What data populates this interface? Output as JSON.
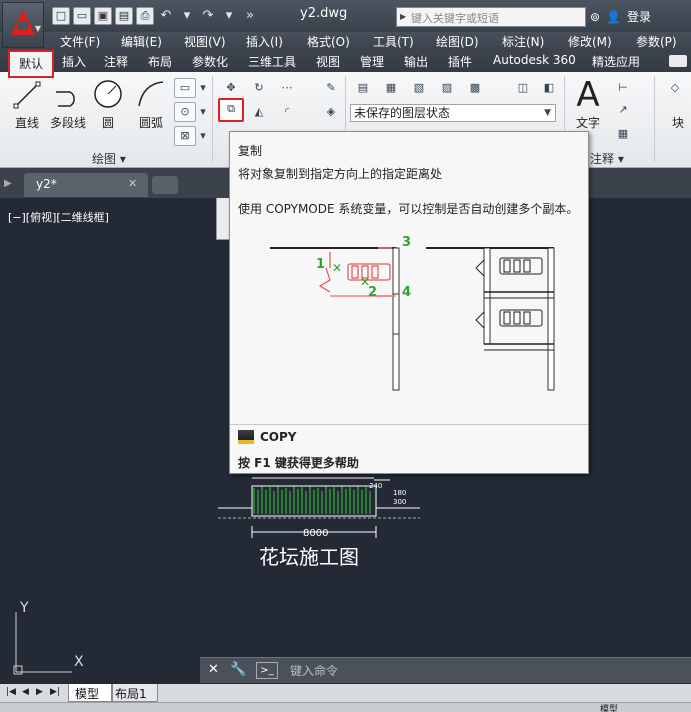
{
  "app": {
    "doc_title": "y2.dwg",
    "search_placeholder": "键入关键字或短语",
    "login": "登录"
  },
  "menu": [
    "文件(F)",
    "编辑(E)",
    "视图(V)",
    "插入(I)",
    "格式(O)",
    "工具(T)",
    "绘图(D)",
    "标注(N)",
    "修改(M)",
    "参数(P)"
  ],
  "ribbon_tabs": [
    "默认",
    "插入",
    "注释",
    "布局",
    "参数化",
    "三维工具",
    "视图",
    "管理",
    "输出",
    "插件",
    "Autodesk 360",
    "精选应用"
  ],
  "draw_panel": {
    "tools": [
      "直线",
      "多段线",
      "圆",
      "圆弧"
    ],
    "title": "绘图 ▾"
  },
  "layer_combo": "未保存的图层状态",
  "text_tool": {
    "glyph": "A",
    "label": "文字"
  },
  "annot_panel_title": "注释 ▾",
  "block_label": "块",
  "file_tab": {
    "name": "y2*",
    "close": "✕"
  },
  "canvas": {
    "view_label": "[−][俯视][二维线框]",
    "drawing_title": "花坛施工图",
    "dim_8000": "8000",
    "dim_240": "240",
    "dim_180": "180",
    "dim_300": "300",
    "ucs_y": "Y",
    "ucs_x": "X"
  },
  "tooltip": {
    "title": "复制",
    "description": "将对象复制到指定方向上的指定距离处",
    "detail": "使用 COPYMODE 系统变量，可以控制是否自动创建多个副本。",
    "markers": [
      "1",
      "2",
      "3",
      "4"
    ],
    "command": "COPY",
    "help": "按 F1 键获得更多帮助"
  },
  "command_line": {
    "close": "✕",
    "prompt_glyph": ">_",
    "placeholder": "键入命令"
  },
  "layout_tabs": [
    "模型",
    "布局1"
  ],
  "status_model": "模型"
}
